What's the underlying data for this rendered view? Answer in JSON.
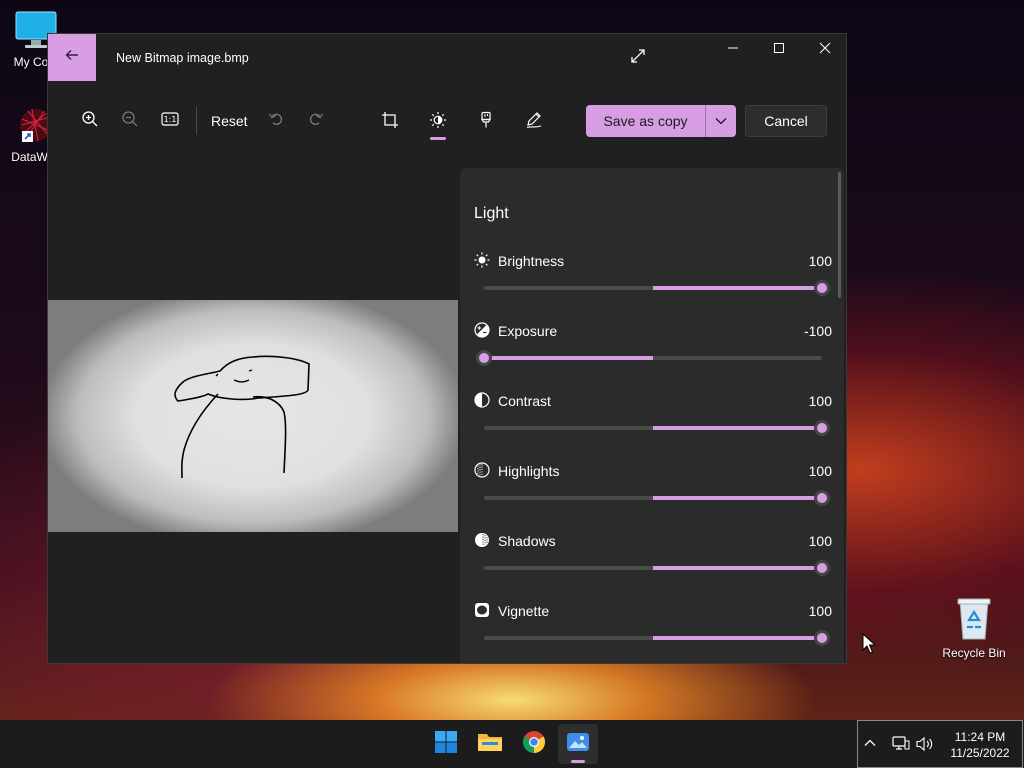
{
  "desktop": {
    "icons": [
      {
        "label": "My Com"
      },
      {
        "label": "DataWag"
      },
      {
        "label": "Recycle Bin"
      }
    ]
  },
  "window": {
    "title": "New Bitmap image.bmp"
  },
  "toolbar": {
    "reset_label": "Reset",
    "save_label": "Save as copy",
    "cancel_label": "Cancel"
  },
  "panel": {
    "title": "Light",
    "adjustments": [
      {
        "name": "Brightness",
        "value": "100",
        "fill_fraction": 1.0
      },
      {
        "name": "Exposure",
        "value": "-100",
        "fill_fraction": 0.0
      },
      {
        "name": "Contrast",
        "value": "100",
        "fill_fraction": 1.0
      },
      {
        "name": "Highlights",
        "value": "100",
        "fill_fraction": 1.0
      },
      {
        "name": "Shadows",
        "value": "100",
        "fill_fraction": 1.0
      },
      {
        "name": "Vignette",
        "value": "100",
        "fill_fraction": 1.0
      }
    ]
  },
  "taskbar": {
    "clock_time": "11:24 PM",
    "clock_date": "11/25/2022"
  },
  "colors": {
    "accent": "#d79ee3",
    "window_bg": "#202020",
    "panel_bg": "#2b2b2b"
  }
}
